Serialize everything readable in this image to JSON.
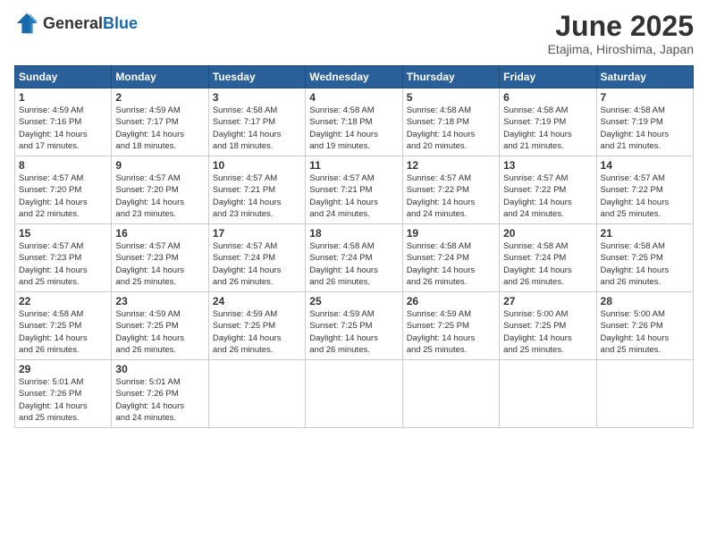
{
  "logo": {
    "general": "General",
    "blue": "Blue"
  },
  "title": "June 2025",
  "subtitle": "Etajima, Hiroshima, Japan",
  "headers": [
    "Sunday",
    "Monday",
    "Tuesday",
    "Wednesday",
    "Thursday",
    "Friday",
    "Saturday"
  ],
  "weeks": [
    [
      {
        "day": "1",
        "info": "Sunrise: 4:59 AM\nSunset: 7:16 PM\nDaylight: 14 hours\nand 17 minutes."
      },
      {
        "day": "2",
        "info": "Sunrise: 4:59 AM\nSunset: 7:17 PM\nDaylight: 14 hours\nand 18 minutes."
      },
      {
        "day": "3",
        "info": "Sunrise: 4:58 AM\nSunset: 7:17 PM\nDaylight: 14 hours\nand 18 minutes."
      },
      {
        "day": "4",
        "info": "Sunrise: 4:58 AM\nSunset: 7:18 PM\nDaylight: 14 hours\nand 19 minutes."
      },
      {
        "day": "5",
        "info": "Sunrise: 4:58 AM\nSunset: 7:18 PM\nDaylight: 14 hours\nand 20 minutes."
      },
      {
        "day": "6",
        "info": "Sunrise: 4:58 AM\nSunset: 7:19 PM\nDaylight: 14 hours\nand 21 minutes."
      },
      {
        "day": "7",
        "info": "Sunrise: 4:58 AM\nSunset: 7:19 PM\nDaylight: 14 hours\nand 21 minutes."
      }
    ],
    [
      {
        "day": "8",
        "info": "Sunrise: 4:57 AM\nSunset: 7:20 PM\nDaylight: 14 hours\nand 22 minutes."
      },
      {
        "day": "9",
        "info": "Sunrise: 4:57 AM\nSunset: 7:20 PM\nDaylight: 14 hours\nand 23 minutes."
      },
      {
        "day": "10",
        "info": "Sunrise: 4:57 AM\nSunset: 7:21 PM\nDaylight: 14 hours\nand 23 minutes."
      },
      {
        "day": "11",
        "info": "Sunrise: 4:57 AM\nSunset: 7:21 PM\nDaylight: 14 hours\nand 24 minutes."
      },
      {
        "day": "12",
        "info": "Sunrise: 4:57 AM\nSunset: 7:22 PM\nDaylight: 14 hours\nand 24 minutes."
      },
      {
        "day": "13",
        "info": "Sunrise: 4:57 AM\nSunset: 7:22 PM\nDaylight: 14 hours\nand 24 minutes."
      },
      {
        "day": "14",
        "info": "Sunrise: 4:57 AM\nSunset: 7:22 PM\nDaylight: 14 hours\nand 25 minutes."
      }
    ],
    [
      {
        "day": "15",
        "info": "Sunrise: 4:57 AM\nSunset: 7:23 PM\nDaylight: 14 hours\nand 25 minutes."
      },
      {
        "day": "16",
        "info": "Sunrise: 4:57 AM\nSunset: 7:23 PM\nDaylight: 14 hours\nand 25 minutes."
      },
      {
        "day": "17",
        "info": "Sunrise: 4:57 AM\nSunset: 7:24 PM\nDaylight: 14 hours\nand 26 minutes."
      },
      {
        "day": "18",
        "info": "Sunrise: 4:58 AM\nSunset: 7:24 PM\nDaylight: 14 hours\nand 26 minutes."
      },
      {
        "day": "19",
        "info": "Sunrise: 4:58 AM\nSunset: 7:24 PM\nDaylight: 14 hours\nand 26 minutes."
      },
      {
        "day": "20",
        "info": "Sunrise: 4:58 AM\nSunset: 7:24 PM\nDaylight: 14 hours\nand 26 minutes."
      },
      {
        "day": "21",
        "info": "Sunrise: 4:58 AM\nSunset: 7:25 PM\nDaylight: 14 hours\nand 26 minutes."
      }
    ],
    [
      {
        "day": "22",
        "info": "Sunrise: 4:58 AM\nSunset: 7:25 PM\nDaylight: 14 hours\nand 26 minutes."
      },
      {
        "day": "23",
        "info": "Sunrise: 4:59 AM\nSunset: 7:25 PM\nDaylight: 14 hours\nand 26 minutes."
      },
      {
        "day": "24",
        "info": "Sunrise: 4:59 AM\nSunset: 7:25 PM\nDaylight: 14 hours\nand 26 minutes."
      },
      {
        "day": "25",
        "info": "Sunrise: 4:59 AM\nSunset: 7:25 PM\nDaylight: 14 hours\nand 26 minutes."
      },
      {
        "day": "26",
        "info": "Sunrise: 4:59 AM\nSunset: 7:25 PM\nDaylight: 14 hours\nand 25 minutes."
      },
      {
        "day": "27",
        "info": "Sunrise: 5:00 AM\nSunset: 7:25 PM\nDaylight: 14 hours\nand 25 minutes."
      },
      {
        "day": "28",
        "info": "Sunrise: 5:00 AM\nSunset: 7:26 PM\nDaylight: 14 hours\nand 25 minutes."
      }
    ],
    [
      {
        "day": "29",
        "info": "Sunrise: 5:01 AM\nSunset: 7:26 PM\nDaylight: 14 hours\nand 25 minutes."
      },
      {
        "day": "30",
        "info": "Sunrise: 5:01 AM\nSunset: 7:26 PM\nDaylight: 14 hours\nand 24 minutes."
      },
      {
        "day": "",
        "info": ""
      },
      {
        "day": "",
        "info": ""
      },
      {
        "day": "",
        "info": ""
      },
      {
        "day": "",
        "info": ""
      },
      {
        "day": "",
        "info": ""
      }
    ]
  ]
}
